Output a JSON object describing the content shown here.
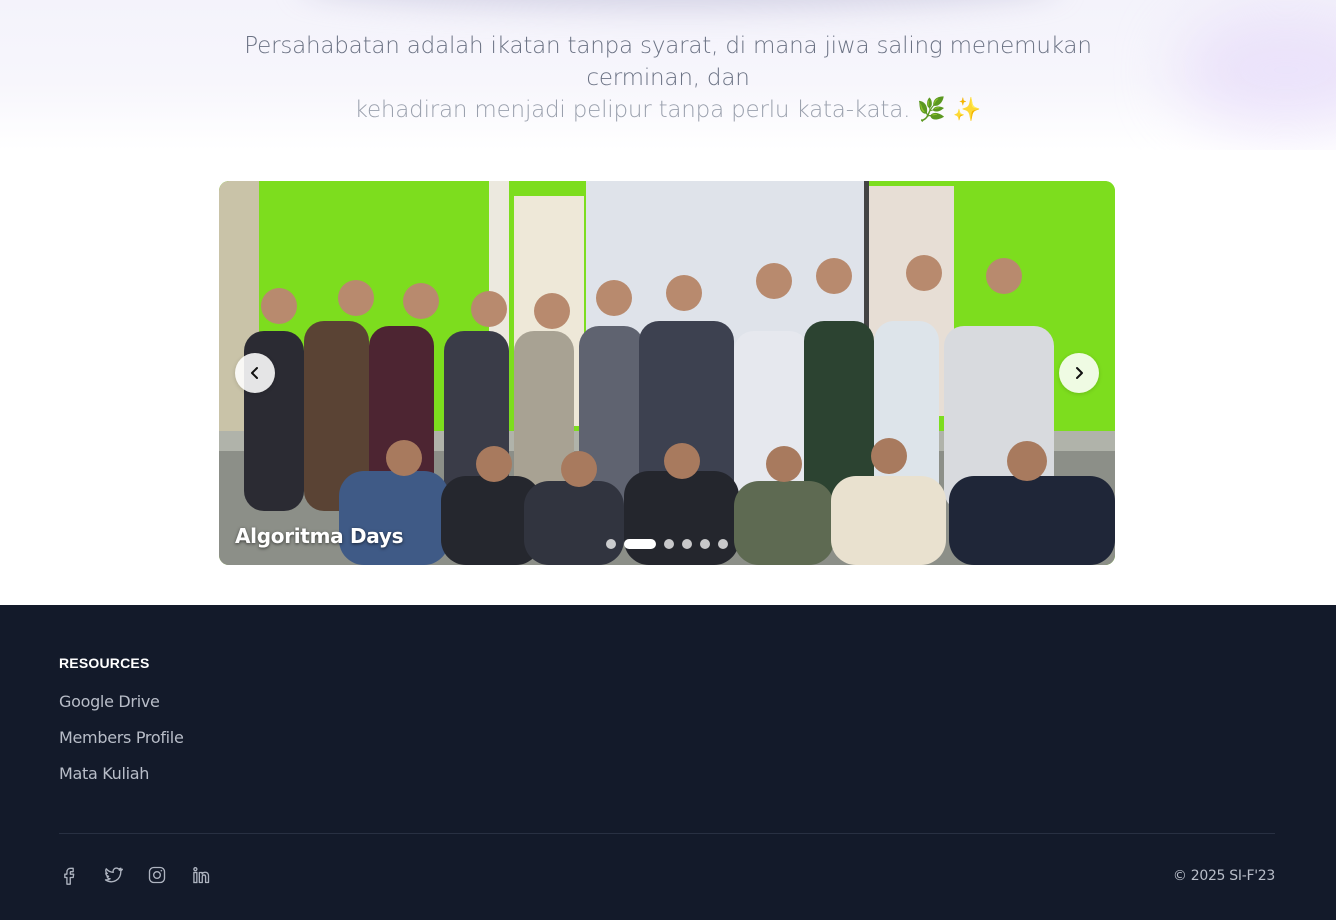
{
  "quote": {
    "line1": "Persahabatan adalah ikatan tanpa syarat, di mana jiwa saling menemukan cerminan, dan",
    "line2": "kehadiran menjadi pelipur tanpa perlu kata-kata. 🌿 ✨"
  },
  "carousel": {
    "caption": "Algoritma Days",
    "slide_count": 6,
    "active_slide": 2,
    "prev_icon": "chevron-left-icon",
    "next_icon": "chevron-right-icon"
  },
  "footer": {
    "resources_heading": "RESOURCES",
    "links": [
      "Google Drive",
      "Members Profile",
      "Mata Kuliah"
    ],
    "socials": [
      "facebook-icon",
      "twitter-icon",
      "instagram-icon",
      "linkedin-icon"
    ],
    "copyright": "© 2025 SI-F'23"
  },
  "colors": {
    "footer_bg": "#131a2a",
    "quote_text": "#6b7284",
    "photo_wall": "#7fe01f"
  }
}
